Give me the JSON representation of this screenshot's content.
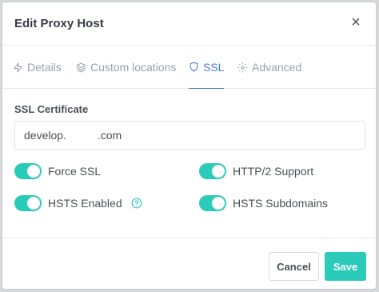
{
  "dialog": {
    "title": "Edit Proxy Host",
    "close_glyph": "×"
  },
  "tabs": [
    {
      "label": "Details",
      "icon": "zap-icon",
      "active": false
    },
    {
      "label": "Custom locations",
      "icon": "layers-icon",
      "active": false
    },
    {
      "label": "SSL",
      "icon": "shield-icon",
      "active": true
    },
    {
      "label": "Advanced",
      "icon": "gear-icon",
      "active": false
    }
  ],
  "ssl": {
    "certificate_label": "SSL Certificate",
    "certificate_value": "develop.          .com",
    "toggles": [
      {
        "label": "Force SSL",
        "on": true
      },
      {
        "label": "HTTP/2 Support",
        "on": true
      },
      {
        "label": "HSTS Enabled",
        "on": true,
        "help_icon": "question-circle-icon"
      },
      {
        "label": "HSTS Subdomains",
        "on": true
      }
    ]
  },
  "footer": {
    "cancel_label": "Cancel",
    "save_label": "Save"
  },
  "colors": {
    "accent": "#467fcf",
    "toggle_on": "#2bcbba",
    "save_button": "#2bcbba",
    "muted_text": "#9aa0ac"
  }
}
